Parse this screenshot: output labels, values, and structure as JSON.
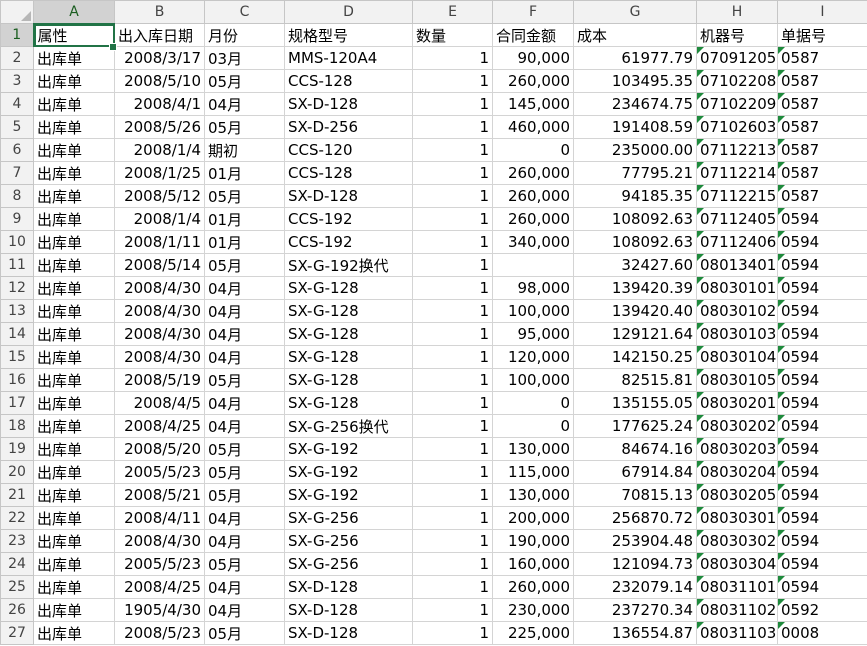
{
  "columns": [
    "A",
    "B",
    "C",
    "D",
    "E",
    "F",
    "G",
    "H",
    "I"
  ],
  "headers": [
    "属性",
    "出入库日期",
    "月份",
    "规格型号",
    "数量",
    "合同金额",
    "成本",
    "机器号",
    "单据号"
  ],
  "rows": [
    [
      "2",
      "出库单",
      "2008/3/17",
      "03月",
      "MMS-120A4",
      "1",
      "90,000",
      "61977.79",
      "07091205",
      "0587"
    ],
    [
      "3",
      "出库单",
      "2008/5/10",
      "05月",
      "CCS-128",
      "1",
      "260,000",
      "103495.35",
      "07102208",
      "0587"
    ],
    [
      "4",
      "出库单",
      "2008/4/1",
      "04月",
      "SX-D-128",
      "1",
      "145,000",
      "234674.75",
      "07102209",
      "0587"
    ],
    [
      "5",
      "出库单",
      "2008/5/26",
      "05月",
      "SX-D-256",
      "1",
      "460,000",
      "191408.59",
      "07102603",
      "0587"
    ],
    [
      "6",
      "出库单",
      "2008/1/4",
      "期初",
      "CCS-120",
      "1",
      "0",
      "235000.00",
      "07112213",
      "0587"
    ],
    [
      "7",
      "出库单",
      "2008/1/25",
      "01月",
      "CCS-128",
      "1",
      "260,000",
      "77795.21",
      "07112214",
      "0587"
    ],
    [
      "8",
      "出库单",
      "2008/5/12",
      "05月",
      "SX-D-128",
      "1",
      "260,000",
      "94185.35",
      "07112215",
      "0587"
    ],
    [
      "9",
      "出库单",
      "2008/1/4",
      "01月",
      "CCS-192",
      "1",
      "260,000",
      "108092.63",
      "07112405",
      "0594"
    ],
    [
      "10",
      "出库单",
      "2008/1/11",
      "01月",
      "CCS-192",
      "1",
      "340,000",
      "108092.63",
      "07112406",
      "0594"
    ],
    [
      "11",
      "出库单",
      "2008/5/14",
      "05月",
      "SX-G-192换代",
      "1",
      "",
      "32427.60",
      "08013401",
      "0594"
    ],
    [
      "12",
      "出库单",
      "2008/4/30",
      "04月",
      "SX-G-128",
      "1",
      "98,000",
      "139420.39",
      "08030101",
      "0594"
    ],
    [
      "13",
      "出库单",
      "2008/4/30",
      "04月",
      "SX-G-128",
      "1",
      "100,000",
      "139420.40",
      "08030102",
      "0594"
    ],
    [
      "14",
      "出库单",
      "2008/4/30",
      "04月",
      "SX-G-128",
      "1",
      "95,000",
      "129121.64",
      "08030103",
      "0594"
    ],
    [
      "15",
      "出库单",
      "2008/4/30",
      "04月",
      "SX-G-128",
      "1",
      "120,000",
      "142150.25",
      "08030104",
      "0594"
    ],
    [
      "16",
      "出库单",
      "2008/5/19",
      "05月",
      "SX-G-128",
      "1",
      "100,000",
      "82515.81",
      "08030105",
      "0594"
    ],
    [
      "17",
      "出库单",
      "2008/4/5",
      "04月",
      "SX-G-128",
      "1",
      "0",
      "135155.05",
      "08030201",
      "0594"
    ],
    [
      "18",
      "出库单",
      "2008/4/25",
      "04月",
      "SX-G-256换代",
      "1",
      "0",
      "177625.24",
      "08030202",
      "0594"
    ],
    [
      "19",
      "出库单",
      "2008/5/20",
      "05月",
      "SX-G-192",
      "1",
      "130,000",
      "84674.16",
      "08030203",
      "0594"
    ],
    [
      "20",
      "出库单",
      "2005/5/23",
      "05月",
      "SX-G-192",
      "1",
      "115,000",
      "67914.84",
      "08030204",
      "0594"
    ],
    [
      "21",
      "出库单",
      "2008/5/21",
      "05月",
      "SX-G-192",
      "1",
      "130,000",
      "70815.13",
      "08030205",
      "0594"
    ],
    [
      "22",
      "出库单",
      "2008/4/11",
      "04月",
      "SX-G-256",
      "1",
      "200,000",
      "256870.72",
      "08030301",
      "0594"
    ],
    [
      "23",
      "出库单",
      "2008/4/30",
      "04月",
      "SX-G-256",
      "1",
      "190,000",
      "253904.48",
      "08030302",
      "0594"
    ],
    [
      "24",
      "出库单",
      "2005/5/23",
      "05月",
      "SX-G-256",
      "1",
      "160,000",
      "121094.73",
      "08030304",
      "0594"
    ],
    [
      "25",
      "出库单",
      "2008/4/25",
      "04月",
      "SX-D-128",
      "1",
      "260,000",
      "232079.14",
      "08031101",
      "0594"
    ],
    [
      "26",
      "出库单",
      "1905/4/30",
      "04月",
      "SX-D-128",
      "1",
      "230,000",
      "237270.34",
      "08031102",
      "0592"
    ],
    [
      "27",
      "出库单",
      "2008/5/23",
      "05月",
      "SX-D-128",
      "1",
      "225,000",
      "136554.87",
      "08031103",
      "0008"
    ]
  ]
}
